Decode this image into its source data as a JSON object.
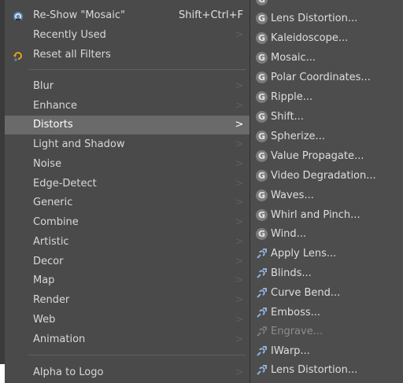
{
  "menu": {
    "top_items": [
      {
        "label": "Re-Show \"Mosaic\"",
        "accel": "Shift+Ctrl+F",
        "icon": "reshow-icon"
      },
      {
        "label": "Recently Used",
        "icon": ""
      },
      {
        "label": "Reset all Filters",
        "icon": "reset-icon"
      }
    ],
    "categories": [
      {
        "label": "Blur"
      },
      {
        "label": "Enhance"
      },
      {
        "label": "Distorts"
      },
      {
        "label": "Light and Shadow"
      },
      {
        "label": "Noise"
      },
      {
        "label": "Edge-Detect"
      },
      {
        "label": "Generic"
      },
      {
        "label": "Combine"
      },
      {
        "label": "Artistic"
      },
      {
        "label": "Decor"
      },
      {
        "label": "Map"
      },
      {
        "label": "Render"
      },
      {
        "label": "Web"
      },
      {
        "label": "Animation"
      }
    ],
    "bottom_items": [
      {
        "label": "Alpha to Logo"
      }
    ],
    "submenu_arrow": ">"
  },
  "submenu": {
    "items": [
      {
        "label": "Lens Distortion...",
        "icon": "gegl-icon",
        "enabled": true
      },
      {
        "label": "Kaleidoscope...",
        "icon": "gegl-icon",
        "enabled": true
      },
      {
        "label": "Mosaic...",
        "icon": "gegl-icon",
        "enabled": true
      },
      {
        "label": "Polar Coordinates...",
        "icon": "gegl-icon",
        "enabled": true
      },
      {
        "label": "Ripple...",
        "icon": "gegl-icon",
        "enabled": true
      },
      {
        "label": "Shift...",
        "icon": "gegl-icon",
        "enabled": true
      },
      {
        "label": "Spherize...",
        "icon": "gegl-icon",
        "enabled": true
      },
      {
        "label": "Value Propagate...",
        "icon": "gegl-icon",
        "enabled": true
      },
      {
        "label": "Video Degradation...",
        "icon": "gegl-icon",
        "enabled": true
      },
      {
        "label": "Waves...",
        "icon": "gegl-icon",
        "enabled": true
      },
      {
        "label": "Whirl and Pinch...",
        "icon": "gegl-icon",
        "enabled": true
      },
      {
        "label": "Wind...",
        "icon": "gegl-icon",
        "enabled": true
      },
      {
        "label": "Apply Lens...",
        "icon": "plugin-icon",
        "enabled": true
      },
      {
        "label": "Blinds...",
        "icon": "plugin-icon",
        "enabled": true
      },
      {
        "label": "Curve Bend...",
        "icon": "plugin-icon",
        "enabled": true
      },
      {
        "label": "Emboss...",
        "icon": "plugin-icon",
        "enabled": true
      },
      {
        "label": "Engrave...",
        "icon": "plugin-icon",
        "enabled": false
      },
      {
        "label": "IWarp...",
        "icon": "plugin-icon",
        "enabled": true
      },
      {
        "label": "Lens Distortion...",
        "icon": "plugin-icon",
        "enabled": true
      }
    ],
    "gegl_glyph": "G"
  },
  "colors": {
    "menu_bg": "#4a4a4a",
    "highlight": "#6a6a6a",
    "text": "#d8d8d8",
    "disabled_text": "#8d8d8d"
  }
}
